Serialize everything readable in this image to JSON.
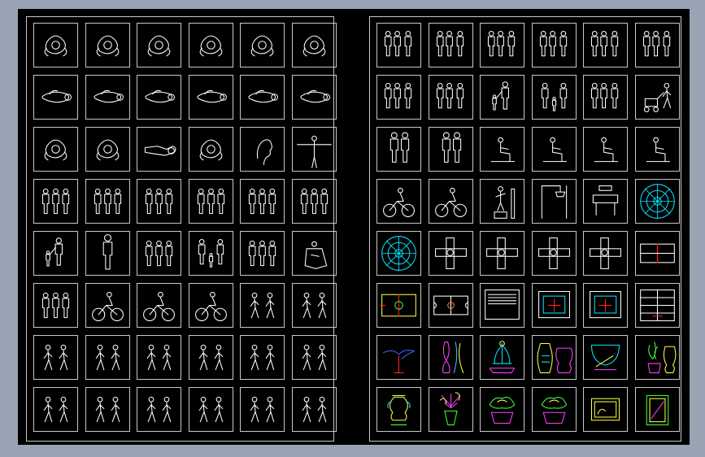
{
  "drawing": {
    "background": "#000000",
    "frame_color": "#c8c8c8",
    "line_color": "#ffffff"
  },
  "left_sheet": {
    "rows": [
      [
        "person-top-view-icon",
        "person-top-view-icon",
        "person-top-view-icon",
        "person-top-view-icon",
        "person-top-view-icon",
        "person-top-view-icon"
      ],
      [
        "person-lying-top-view-icon",
        "person-lying-top-view-icon",
        "person-lying-top-view-icon",
        "person-lying-top-view-icon",
        "person-lying-top-view-icon",
        "person-lying-top-view-icon"
      ],
      [
        "person-top-view-icon",
        "person-top-view-icon",
        "person-reclining-icon",
        "person-top-view-icon",
        "head-profile-icon",
        "arms-spread-figure-icon"
      ],
      [
        "standing-people-outline-icon",
        "standing-people-outline-icon",
        "standing-people-outline-icon",
        "standing-people-outline-icon",
        "standing-people-outline-icon",
        "standing-people-outline-icon"
      ],
      [
        "adult-with-child-icon",
        "standing-person-icon",
        "standing-people-outline-icon",
        "family-group-icon",
        "standing-people-outline-icon",
        "wheelchair-user-icon"
      ],
      [
        "standing-people-outline-icon",
        "cyclist-icon",
        "cyclist-icon",
        "cyclist-icon",
        "walking-people-icon",
        "walking-people-icon"
      ],
      [
        "walking-people-icon",
        "walking-people-icon",
        "walking-people-icon",
        "walking-people-icon",
        "walking-people-icon",
        "walking-people-icon"
      ],
      [
        "walking-people-icon",
        "walking-people-icon",
        "walking-people-icon",
        "walking-people-icon",
        "walking-people-icon",
        "walking-people-icon"
      ]
    ]
  },
  "right_sheet": {
    "rows": [
      [
        "people-group-icon",
        "people-group-icon",
        "people-group-icon",
        "people-group-icon",
        "people-group-icon",
        "people-group-icon"
      ],
      [
        "people-group-icon",
        "people-group-icon",
        "adult-with-child-icon",
        "family-group-icon",
        "people-group-icon",
        "person-with-stroller-icon"
      ],
      [
        "couple-icon",
        "couple-icon",
        "seated-person-icon",
        "seated-person-icon",
        "seated-person-icon",
        "seated-person-icon"
      ],
      [
        "cyclist-icon",
        "cyclist-icon",
        "statue-icon",
        "basketball-hoop-icon",
        "table-icon",
        "round-table-top-view-icon"
      ],
      [
        "round-table-top-view-icon",
        "playground-top-view-icon",
        "playground-top-view-icon",
        "playground-top-view-icon",
        "playground-top-view-icon",
        "tennis-court-icon"
      ],
      [
        "football-field-icon",
        "basketball-court-icon",
        "stage-icon",
        "court-icon",
        "court-icon",
        "window-grid-icon"
      ],
      [
        "bird-sculpture-icon",
        "vase-icon",
        "fountain-icon",
        "vase-pair-icon",
        "fish-bowl-icon",
        "potted-plant-icon"
      ],
      [
        "urn-icon",
        "flower-vase-icon",
        "planter-icon",
        "planter-icon",
        "picture-frame-icon",
        "cabinet-icon"
      ]
    ]
  }
}
